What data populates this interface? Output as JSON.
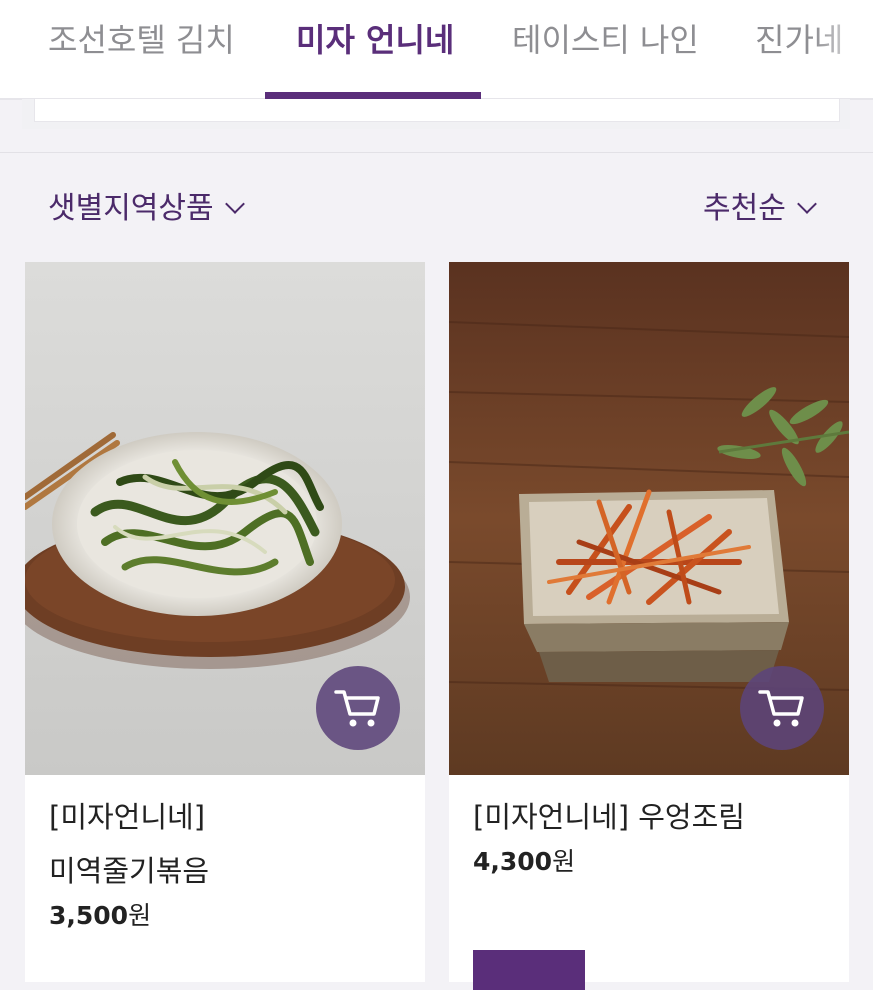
{
  "tabs": [
    {
      "label": "조선호텔 김치",
      "active": false
    },
    {
      "label": "미자 언니네",
      "active": true
    },
    {
      "label": "테이스티 나인",
      "active": false
    },
    {
      "label": "진가네",
      "active": false
    }
  ],
  "filters": {
    "category_label": "샛별지역상품",
    "sort_label": "추천순"
  },
  "products": [
    {
      "brand": "[미자언니네]",
      "name": "미역줄기볶음",
      "price": "3,500",
      "price_unit": "원",
      "image": "stir-fried seaweed stems on white plate with chopsticks"
    },
    {
      "brand": "[미자언니네]",
      "name": "우엉조림",
      "price": "4,300",
      "price_unit": "원",
      "image": "braised burdock in ceramic bowl on wooden table"
    }
  ],
  "colors": {
    "accent": "#5a2e7a",
    "tab_inactive": "#8e8e92",
    "background": "#f3f2f6",
    "cart_button": "#5c447a"
  },
  "icons": [
    "chevron-down-icon",
    "cart-icon"
  ]
}
